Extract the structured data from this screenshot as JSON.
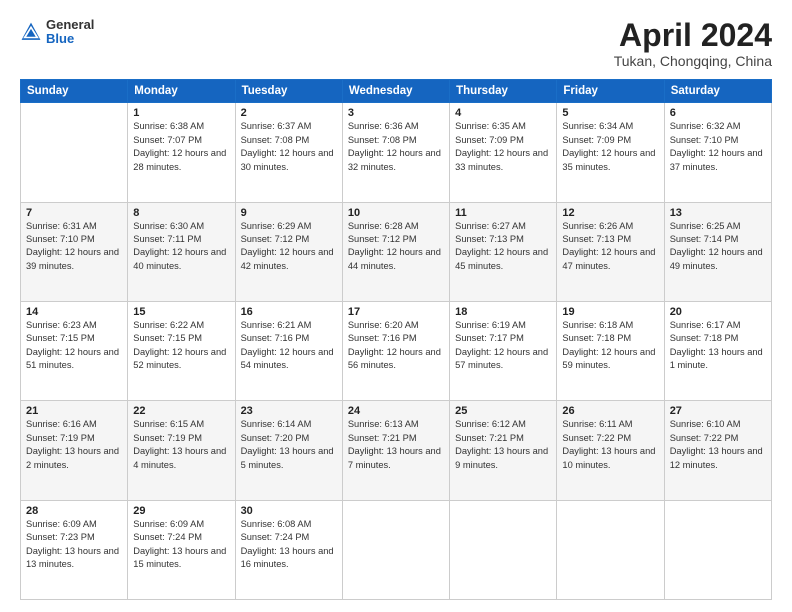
{
  "header": {
    "logo_general": "General",
    "logo_blue": "Blue",
    "title": "April 2024",
    "location": "Tukan, Chongqing, China"
  },
  "columns": [
    "Sunday",
    "Monday",
    "Tuesday",
    "Wednesday",
    "Thursday",
    "Friday",
    "Saturday"
  ],
  "weeks": [
    [
      {
        "day": "",
        "sunrise": "",
        "sunset": "",
        "daylight": ""
      },
      {
        "day": "1",
        "sunrise": "Sunrise: 6:38 AM",
        "sunset": "Sunset: 7:07 PM",
        "daylight": "Daylight: 12 hours and 28 minutes."
      },
      {
        "day": "2",
        "sunrise": "Sunrise: 6:37 AM",
        "sunset": "Sunset: 7:08 PM",
        "daylight": "Daylight: 12 hours and 30 minutes."
      },
      {
        "day": "3",
        "sunrise": "Sunrise: 6:36 AM",
        "sunset": "Sunset: 7:08 PM",
        "daylight": "Daylight: 12 hours and 32 minutes."
      },
      {
        "day": "4",
        "sunrise": "Sunrise: 6:35 AM",
        "sunset": "Sunset: 7:09 PM",
        "daylight": "Daylight: 12 hours and 33 minutes."
      },
      {
        "day": "5",
        "sunrise": "Sunrise: 6:34 AM",
        "sunset": "Sunset: 7:09 PM",
        "daylight": "Daylight: 12 hours and 35 minutes."
      },
      {
        "day": "6",
        "sunrise": "Sunrise: 6:32 AM",
        "sunset": "Sunset: 7:10 PM",
        "daylight": "Daylight: 12 hours and 37 minutes."
      }
    ],
    [
      {
        "day": "7",
        "sunrise": "Sunrise: 6:31 AM",
        "sunset": "Sunset: 7:10 PM",
        "daylight": "Daylight: 12 hours and 39 minutes."
      },
      {
        "day": "8",
        "sunrise": "Sunrise: 6:30 AM",
        "sunset": "Sunset: 7:11 PM",
        "daylight": "Daylight: 12 hours and 40 minutes."
      },
      {
        "day": "9",
        "sunrise": "Sunrise: 6:29 AM",
        "sunset": "Sunset: 7:12 PM",
        "daylight": "Daylight: 12 hours and 42 minutes."
      },
      {
        "day": "10",
        "sunrise": "Sunrise: 6:28 AM",
        "sunset": "Sunset: 7:12 PM",
        "daylight": "Daylight: 12 hours and 44 minutes."
      },
      {
        "day": "11",
        "sunrise": "Sunrise: 6:27 AM",
        "sunset": "Sunset: 7:13 PM",
        "daylight": "Daylight: 12 hours and 45 minutes."
      },
      {
        "day": "12",
        "sunrise": "Sunrise: 6:26 AM",
        "sunset": "Sunset: 7:13 PM",
        "daylight": "Daylight: 12 hours and 47 minutes."
      },
      {
        "day": "13",
        "sunrise": "Sunrise: 6:25 AM",
        "sunset": "Sunset: 7:14 PM",
        "daylight": "Daylight: 12 hours and 49 minutes."
      }
    ],
    [
      {
        "day": "14",
        "sunrise": "Sunrise: 6:23 AM",
        "sunset": "Sunset: 7:15 PM",
        "daylight": "Daylight: 12 hours and 51 minutes."
      },
      {
        "day": "15",
        "sunrise": "Sunrise: 6:22 AM",
        "sunset": "Sunset: 7:15 PM",
        "daylight": "Daylight: 12 hours and 52 minutes."
      },
      {
        "day": "16",
        "sunrise": "Sunrise: 6:21 AM",
        "sunset": "Sunset: 7:16 PM",
        "daylight": "Daylight: 12 hours and 54 minutes."
      },
      {
        "day": "17",
        "sunrise": "Sunrise: 6:20 AM",
        "sunset": "Sunset: 7:16 PM",
        "daylight": "Daylight: 12 hours and 56 minutes."
      },
      {
        "day": "18",
        "sunrise": "Sunrise: 6:19 AM",
        "sunset": "Sunset: 7:17 PM",
        "daylight": "Daylight: 12 hours and 57 minutes."
      },
      {
        "day": "19",
        "sunrise": "Sunrise: 6:18 AM",
        "sunset": "Sunset: 7:18 PM",
        "daylight": "Daylight: 12 hours and 59 minutes."
      },
      {
        "day": "20",
        "sunrise": "Sunrise: 6:17 AM",
        "sunset": "Sunset: 7:18 PM",
        "daylight": "Daylight: 13 hours and 1 minute."
      }
    ],
    [
      {
        "day": "21",
        "sunrise": "Sunrise: 6:16 AM",
        "sunset": "Sunset: 7:19 PM",
        "daylight": "Daylight: 13 hours and 2 minutes."
      },
      {
        "day": "22",
        "sunrise": "Sunrise: 6:15 AM",
        "sunset": "Sunset: 7:19 PM",
        "daylight": "Daylight: 13 hours and 4 minutes."
      },
      {
        "day": "23",
        "sunrise": "Sunrise: 6:14 AM",
        "sunset": "Sunset: 7:20 PM",
        "daylight": "Daylight: 13 hours and 5 minutes."
      },
      {
        "day": "24",
        "sunrise": "Sunrise: 6:13 AM",
        "sunset": "Sunset: 7:21 PM",
        "daylight": "Daylight: 13 hours and 7 minutes."
      },
      {
        "day": "25",
        "sunrise": "Sunrise: 6:12 AM",
        "sunset": "Sunset: 7:21 PM",
        "daylight": "Daylight: 13 hours and 9 minutes."
      },
      {
        "day": "26",
        "sunrise": "Sunrise: 6:11 AM",
        "sunset": "Sunset: 7:22 PM",
        "daylight": "Daylight: 13 hours and 10 minutes."
      },
      {
        "day": "27",
        "sunrise": "Sunrise: 6:10 AM",
        "sunset": "Sunset: 7:22 PM",
        "daylight": "Daylight: 13 hours and 12 minutes."
      }
    ],
    [
      {
        "day": "28",
        "sunrise": "Sunrise: 6:09 AM",
        "sunset": "Sunset: 7:23 PM",
        "daylight": "Daylight: 13 hours and 13 minutes."
      },
      {
        "day": "29",
        "sunrise": "Sunrise: 6:09 AM",
        "sunset": "Sunset: 7:24 PM",
        "daylight": "Daylight: 13 hours and 15 minutes."
      },
      {
        "day": "30",
        "sunrise": "Sunrise: 6:08 AM",
        "sunset": "Sunset: 7:24 PM",
        "daylight": "Daylight: 13 hours and 16 minutes."
      },
      {
        "day": "",
        "sunrise": "",
        "sunset": "",
        "daylight": ""
      },
      {
        "day": "",
        "sunrise": "",
        "sunset": "",
        "daylight": ""
      },
      {
        "day": "",
        "sunrise": "",
        "sunset": "",
        "daylight": ""
      },
      {
        "day": "",
        "sunrise": "",
        "sunset": "",
        "daylight": ""
      }
    ]
  ]
}
